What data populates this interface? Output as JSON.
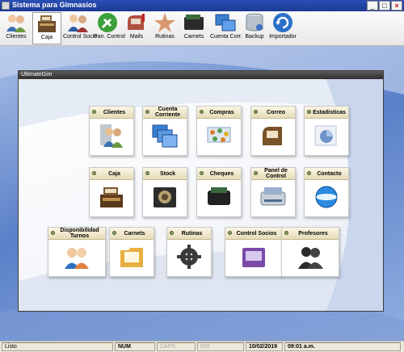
{
  "window": {
    "title": "Sistema para Gimnasios",
    "min": "_",
    "max": "□",
    "close": "×"
  },
  "toolbar": {
    "items": [
      {
        "label": "Clientes",
        "icon": "people-icon"
      },
      {
        "label": "Caja",
        "icon": "cash-register-icon"
      },
      {
        "label": "Control Socio",
        "icon": "people-icon"
      },
      {
        "label": "Pan. Control",
        "icon": "wrench-icon"
      },
      {
        "label": "Mails",
        "icon": "mailbox-icon"
      },
      {
        "label": "Rutinas",
        "icon": "starfish-icon"
      },
      {
        "label": "Carnets",
        "icon": "wallet-icon"
      },
      {
        "label": "Cuenta Corr.",
        "icon": "windows-icon"
      },
      {
        "label": "Backup",
        "icon": "database-icon"
      },
      {
        "label": "Importador",
        "icon": "refresh-icon"
      }
    ]
  },
  "panel": {
    "title": "UltimateGim",
    "cards": [
      {
        "label": "Clientes",
        "icon": "people-icon"
      },
      {
        "label": "Cuenta Corriente",
        "icon": "windows-icon"
      },
      {
        "label": "Compras",
        "icon": "shopping-cart-icon"
      },
      {
        "label": "Correo",
        "icon": "mailbox-icon"
      },
      {
        "label": "Estadisticas",
        "icon": "pie-chart-icon"
      },
      {
        "label": "Caja",
        "icon": "cash-register-icon"
      },
      {
        "label": "Stock",
        "icon": "safe-icon"
      },
      {
        "label": "Cheques",
        "icon": "wallet-icon"
      },
      {
        "label": "Panel de Control",
        "icon": "scanner-icon"
      },
      {
        "label": "Contacto",
        "icon": "globe-icon"
      },
      {
        "label": "Disponibilidad Turnos",
        "icon": "couple-icon"
      },
      {
        "label": "Carnets",
        "icon": "folder-icon"
      },
      {
        "label": "Rutinas",
        "icon": "gears-icon"
      },
      {
        "label": "Control Socios",
        "icon": "folder-purple-icon"
      },
      {
        "label": "Profesores",
        "icon": "silhouette-icon"
      }
    ]
  },
  "status": {
    "ready": "Listo",
    "num": "NUM",
    "caps": "CAPS",
    "ins": "INS",
    "date": "10/02/2019",
    "time": "09:01 a.m."
  }
}
